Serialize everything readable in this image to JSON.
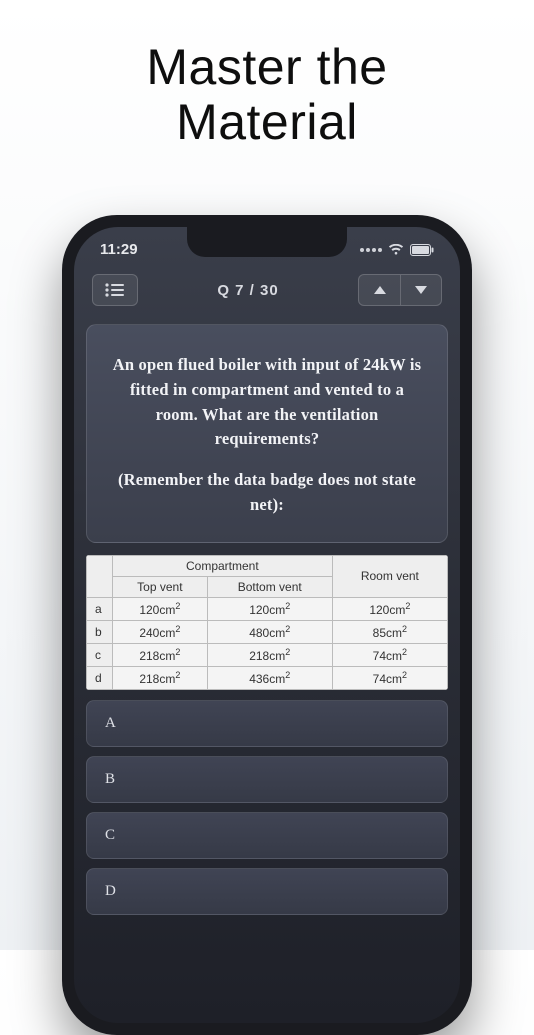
{
  "headline": {
    "line1": "Master the",
    "line2": "Material"
  },
  "status": {
    "time": "11:29"
  },
  "nav": {
    "progress": "Q 7 / 30"
  },
  "question": {
    "text1": "An open flued boiler with input of 24kW is fitted in compartment and vented to a room. What are the ventilation requirements?",
    "text2": "(Remember the data badge does not state net):"
  },
  "table": {
    "header_compartment": "Compartment",
    "header_top": "Top vent",
    "header_bottom": "Bottom vent",
    "header_room": "Room vent",
    "rows": [
      {
        "label": "a",
        "top": "120cm",
        "bottom": "120cm",
        "room": "120cm"
      },
      {
        "label": "b",
        "top": "240cm",
        "bottom": "480cm",
        "room": "85cm"
      },
      {
        "label": "c",
        "top": "218cm",
        "bottom": "218cm",
        "room": "74cm"
      },
      {
        "label": "d",
        "top": "218cm",
        "bottom": "436cm",
        "room": "74cm"
      }
    ]
  },
  "answers": [
    "A",
    "B",
    "C",
    "D"
  ]
}
